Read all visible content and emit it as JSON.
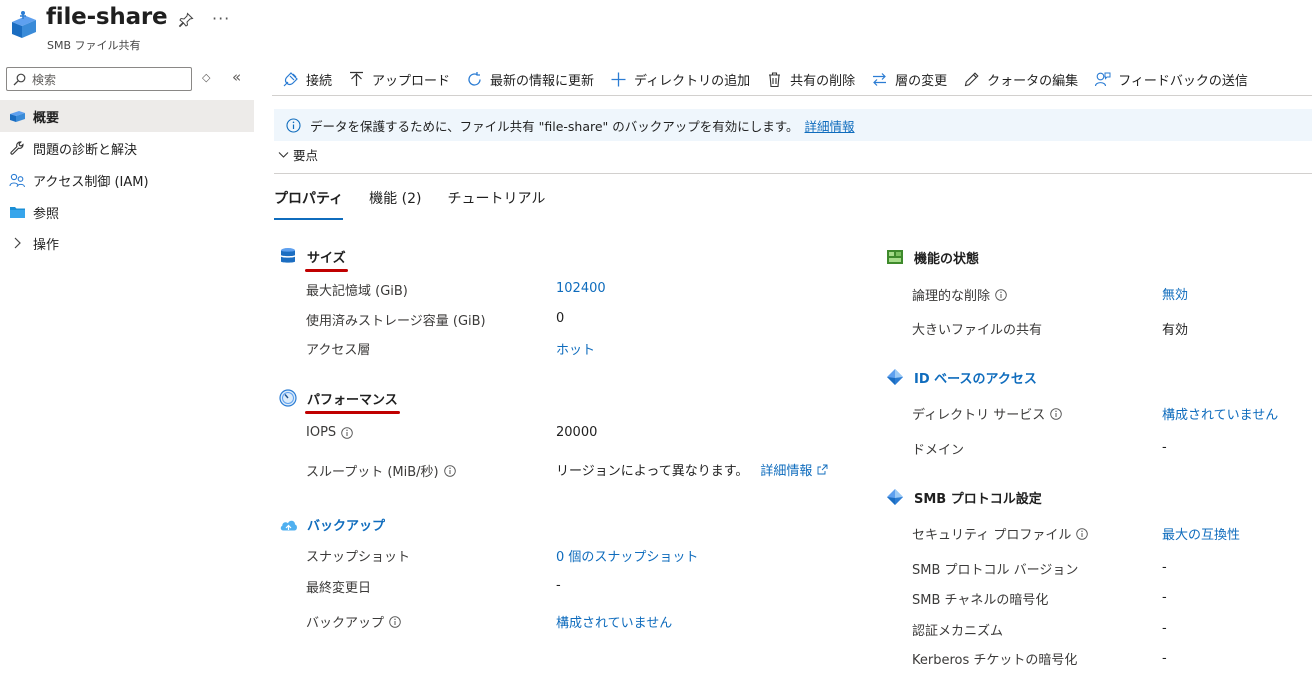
{
  "header": {
    "title": "file-share",
    "subtitle": "SMB ファイル共有",
    "more": "···"
  },
  "nav": {
    "search_placeholder": "検索",
    "items": [
      {
        "label": "概要",
        "icon": "file-share-icon",
        "active": true
      },
      {
        "label": "問題の診断と解決",
        "icon": "wrench-icon"
      },
      {
        "label": "アクセス制御 (IAM)",
        "icon": "people-icon"
      },
      {
        "label": "参照",
        "icon": "folder-icon"
      },
      {
        "label": "操作",
        "icon": "chevron-right-icon"
      }
    ]
  },
  "toolbar": {
    "connect": "接続",
    "upload": "アップロード",
    "refresh": "最新の情報に更新",
    "add_directory": "ディレクトリの追加",
    "delete_share": "共有の削除",
    "change_tier": "層の変更",
    "edit_quota": "クォータの編集",
    "feedback": "フィードバックの送信"
  },
  "banner": {
    "text": "データを保護するために、ファイル共有 \"file-share\" のバックアップを有効にします。",
    "link": "詳細情報"
  },
  "essentials": "要点",
  "tabs": [
    "プロパティ",
    "機能 (2)",
    "チュートリアル"
  ],
  "size": {
    "title": "サイズ",
    "rows": [
      {
        "label": "最大記憶域 (GiB)",
        "value": "102400"
      },
      {
        "label": "使用済みストレージ容量 (GiB)",
        "value": "0"
      },
      {
        "label": "アクセス層",
        "value": "ホット"
      }
    ]
  },
  "performance": {
    "title": "パフォーマンス",
    "rows": [
      {
        "label": "IOPS",
        "value": "20000"
      },
      {
        "label": "スループット (MiB/秒)",
        "value": "リージョンによって異なります。",
        "link": "詳細情報"
      }
    ]
  },
  "backup": {
    "title": "バックアップ",
    "rows": [
      {
        "label": "スナップショット",
        "value": "0 個のスナップショット"
      },
      {
        "label": "最終変更日",
        "value": "-"
      },
      {
        "label": "バックアップ",
        "value": "構成されていません"
      }
    ]
  },
  "feature_status": {
    "title": "機能の状態",
    "rows": [
      {
        "label": "論理的な削除",
        "value": "無効"
      },
      {
        "label": "大きいファイルの共有",
        "value": "有効"
      }
    ]
  },
  "identity": {
    "title": "ID ベースのアクセス",
    "rows": [
      {
        "label": "ディレクトリ サービス",
        "value": "構成されていません"
      },
      {
        "label": "ドメイン",
        "value": "-"
      }
    ]
  },
  "smb": {
    "title": "SMB プロトコル設定",
    "rows": [
      {
        "label": "セキュリティ プロファイル",
        "value": "最大の互換性"
      },
      {
        "label": "SMB プロトコル バージョン",
        "value": "-"
      },
      {
        "label": "SMB チャネルの暗号化",
        "value": "-"
      },
      {
        "label": "認証メカニズム",
        "value": "-"
      },
      {
        "label": "Kerberos チケットの暗号化",
        "value": "-"
      }
    ]
  },
  "colors": {
    "accent": "#0f6cbd",
    "highlight": "#c00000"
  }
}
